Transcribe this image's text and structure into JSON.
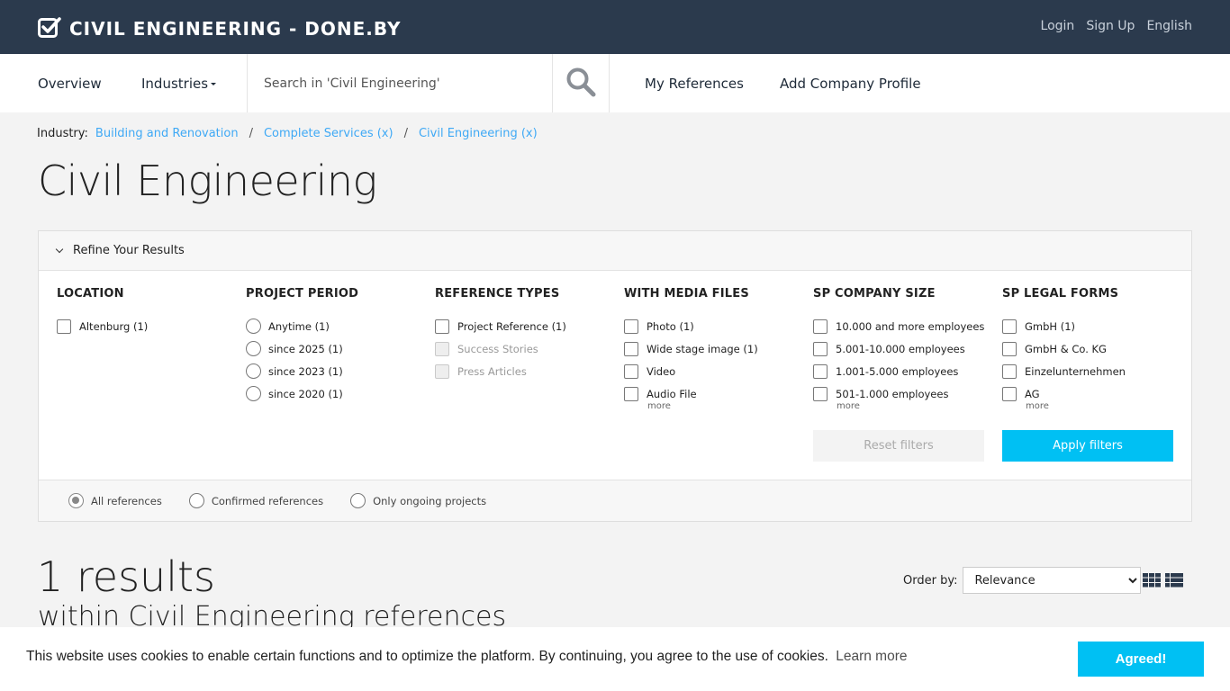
{
  "header": {
    "brand": "CIVIL ENGINEERING - DONE.BY",
    "links": [
      "Login",
      "Sign Up",
      "English"
    ]
  },
  "nav": {
    "overview": "Overview",
    "industries": "Industries",
    "search_placeholder": "Search in 'Civil Engineering'",
    "my_references": "My References",
    "add_company": "Add Company Profile"
  },
  "breadcrumb": {
    "label": "Industry:",
    "items": [
      "Building and Renovation",
      "Complete Services (x)",
      "Civil Engineering (x)"
    ],
    "sep": "/"
  },
  "page_title": "Civil Engineering",
  "filters": {
    "toggle": "Refine Your Results",
    "location": {
      "title": "LOCATION",
      "options": [
        "Altenburg (1)"
      ]
    },
    "period": {
      "title": "PROJECT PERIOD",
      "options": [
        "Anytime (1)",
        "since 2025 (1)",
        "since 2023 (1)",
        "since 2020 (1)"
      ]
    },
    "types": {
      "title": "REFERENCE TYPES",
      "options": [
        "Project Reference (1)",
        "Success Stories",
        "Press Articles"
      ]
    },
    "media": {
      "title": "WITH MEDIA FILES",
      "options": [
        "Photo (1)",
        "Wide stage image (1)",
        "Video",
        "Audio File"
      ],
      "more": "more"
    },
    "size": {
      "title": "SP COMPANY SIZE",
      "options": [
        "10.000 and more employees",
        "5.001-10.000 employees",
        "1.001-5.000 employees",
        "501-1.000 employees"
      ],
      "more": "more"
    },
    "legal": {
      "title": "SP LEGAL FORMS",
      "options": [
        "GmbH (1)",
        "GmbH & Co. KG",
        "Einzelunternehmen",
        "AG"
      ],
      "more": "more"
    },
    "reset": "Reset filters",
    "apply": "Apply filters",
    "scope": [
      "All references",
      "Confirmed references",
      "Only ongoing projects"
    ]
  },
  "results": {
    "count": "1 results",
    "subtitle": "within Civil Engineering references",
    "order_label": "Order by:",
    "order_value": "Relevance"
  },
  "cookie": {
    "text": "This website uses cookies to enable certain functions and to optimize the platform. By continuing, you agree to the use of cookies.",
    "learn_more": "Learn more",
    "button": "Agreed!"
  },
  "colors": {
    "topbar": "#2b3a4d",
    "accent": "#00c0f3",
    "link": "#3fa9f5"
  },
  "icons": {
    "brand": "checkbox-check-icon",
    "search": "search-icon",
    "grid_view": "grid-view-icon",
    "list_view": "list-view-icon"
  }
}
